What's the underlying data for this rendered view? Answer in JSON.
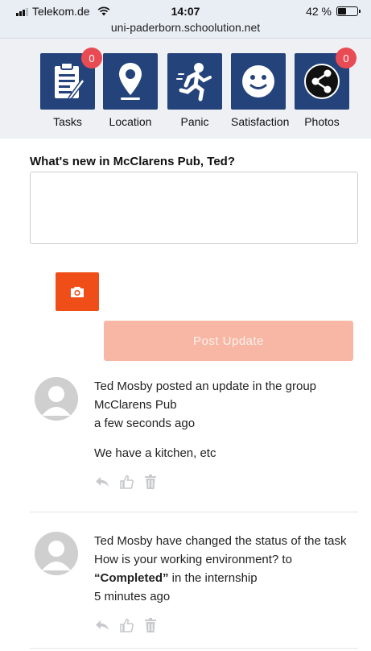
{
  "status_bar": {
    "carrier": "Telekom.de",
    "time": "14:07",
    "battery_percent": "42 %",
    "battery_level": 0.42,
    "url": "uni-paderborn.schoolution.net"
  },
  "apps": [
    {
      "label": "Tasks",
      "icon": "clipboard-icon",
      "badge": "0"
    },
    {
      "label": "Location",
      "icon": "location-pin-icon",
      "badge": null
    },
    {
      "label": "Panic",
      "icon": "running-person-icon",
      "badge": null
    },
    {
      "label": "Satisfaction",
      "icon": "smiley-icon",
      "badge": null
    },
    {
      "label": "Photos",
      "icon": "share-icon",
      "badge": "0"
    }
  ],
  "composer": {
    "prompt": "What's new in McClarens Pub, Ted?",
    "value": "",
    "post_label": "Post Update"
  },
  "colors": {
    "app_tile": "#24437a",
    "badge": "#e94b55",
    "camera_button": "#f04e18",
    "post_button": "#f7b7a4"
  },
  "feed": [
    {
      "text": "Ted Mosby posted an update in the group McClarens Pub",
      "time": "a few seconds ago",
      "message": "We have a kitchen, etc"
    },
    {
      "text_before": "Ted Mosby have changed the status of the task How is your working environment? to ",
      "status": "“Completed”",
      "text_after": " in the internship",
      "time": "5 minutes ago"
    }
  ]
}
